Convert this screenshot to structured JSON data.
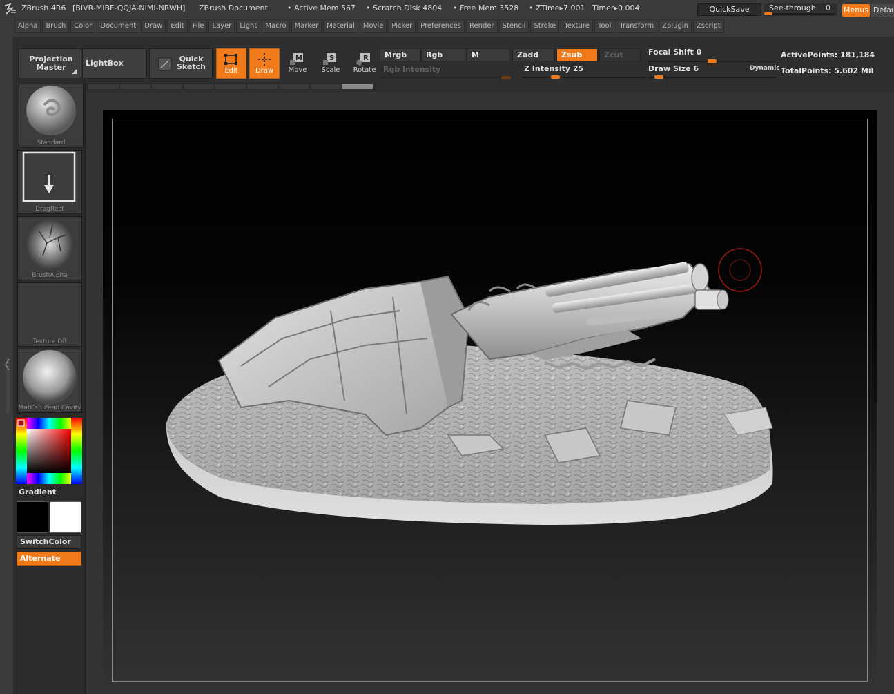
{
  "titlebar": {
    "app": "ZBrush 4R6",
    "serial": "[BIVR-MIBF-QQJA-NIMI-NRWH]",
    "document": "ZBrush Document",
    "active_mem": "• Active Mem 567",
    "scratch_disk": "• Scratch Disk 4804",
    "free_mem": "• Free Mem 3528",
    "ztime": "• ZTime▸7.001",
    "timer": "Timer▸0.004",
    "quicksave": "QuickSave",
    "see_through_label": "See-through",
    "see_through_value": "0",
    "see_through_level": 0.0,
    "menus": "Menus",
    "default": "DefaultZScript"
  },
  "menubar": {
    "items": [
      "Alpha",
      "Brush",
      "Color",
      "Document",
      "Draw",
      "Edit",
      "File",
      "Layer",
      "Light",
      "Macro",
      "Marker",
      "Material",
      "Movie",
      "Picker",
      "Preferences",
      "Render",
      "Stencil",
      "Stroke",
      "Texture",
      "Tool",
      "Transform",
      "Zplugin",
      "Zscript"
    ]
  },
  "shelf": {
    "projection_master": "Projection Master",
    "lightbox": "LightBox",
    "quick_sketch": "Quick Sketch",
    "edit": "Edit",
    "draw": "Draw",
    "move": "Move",
    "scale": "Scale",
    "rotate": "Rotate",
    "mrgb": "Mrgb",
    "rgb": "Rgb",
    "m": "M",
    "zadd": "Zadd",
    "zsub": "Zsub",
    "zcut": "Zcut",
    "rgb_intensity": "Rgb Intensity",
    "z_intensity": "Z Intensity 25",
    "z_intensity_value": 25,
    "focal_shift": "Focal Shift 0",
    "focal_shift_value": 0,
    "draw_size": "Draw Size 6",
    "draw_size_value": 6,
    "dynamic": "Dynamic",
    "active_points": "ActivePoints: 181,184",
    "total_points": "TotalPoints: 5.602 Mil"
  },
  "leftpanel": {
    "brush": "Standard",
    "stroke": "DragRect",
    "alpha": "BrushAlpha",
    "texture": "Texture Off",
    "material": "MatCap Pearl Cavity",
    "gradient": "Gradient",
    "switchcolor": "SwitchColor",
    "alternate": "Alternate"
  },
  "colors": {
    "accent": "#f07a1a",
    "panel": "#2b2b2b",
    "canvas_top": "#000000",
    "canvas_bottom": "#333333"
  }
}
